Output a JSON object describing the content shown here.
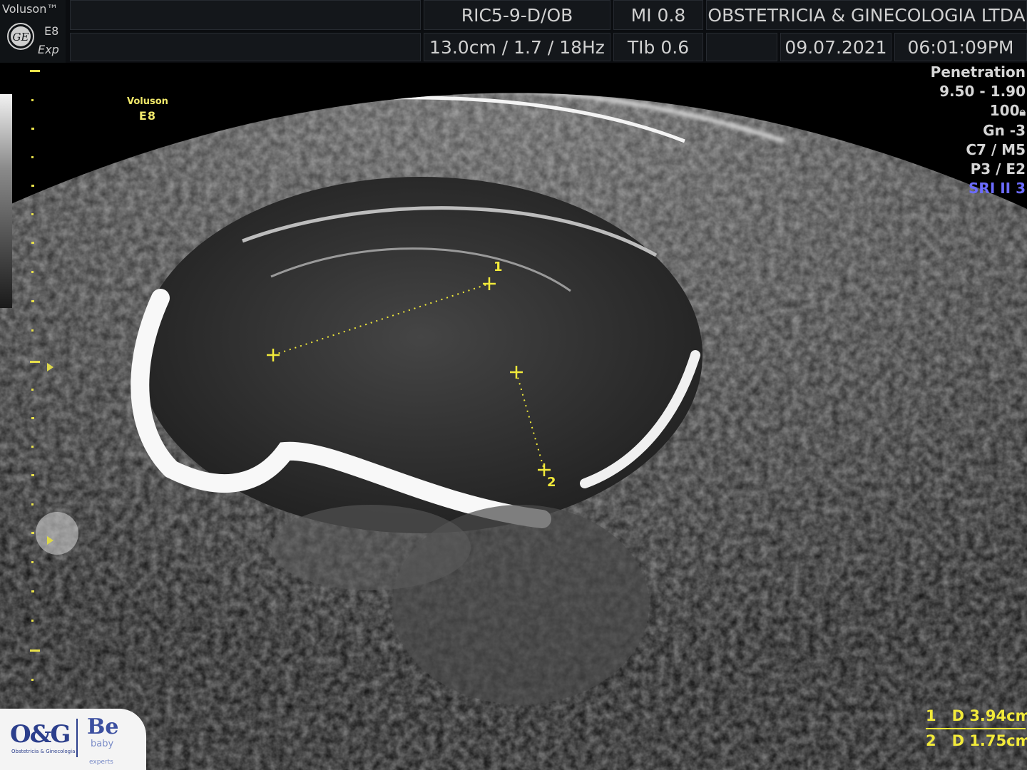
{
  "header": {
    "brand_name": "Voluson™",
    "logo_text": "GE",
    "model": "E8",
    "mode": "Exp",
    "probe": "RIC5-9-D/OB",
    "mi": "MI  0.8",
    "clinic": "OBSTETRICIA & GINECOLOGIA LTDA",
    "depth": "13.0cm / 1.7 / 18Hz",
    "tib": "TIb  0.6",
    "date": "09.07.2021",
    "time": "06:01:09PM"
  },
  "overlay": {
    "brand": "Voluson",
    "model": "E8"
  },
  "params": {
    "mode": "Penetration",
    "range": "9.50 - 1.90",
    "power": "100",
    "gain": "Gn  -3",
    "cm": "C7 / M5",
    "pe": "P3 / E2",
    "sri": "SRI II 3"
  },
  "calipers": [
    {
      "label": "1"
    },
    {
      "label": "2"
    }
  ],
  "measurements": [
    {
      "index": "1",
      "type": "D",
      "value": "3.94cm"
    },
    {
      "index": "2",
      "type": "D",
      "value": "1.75cm"
    }
  ],
  "logos": {
    "og": "O&G",
    "og_sub": "Obstetricia & Ginecologia",
    "be": "Be",
    "be_sub": "baby",
    "be_sub2": "experts"
  },
  "colors": {
    "caliper": "#f2ea3a",
    "sri": "#6b6bff",
    "header_bg": "#14171b"
  }
}
